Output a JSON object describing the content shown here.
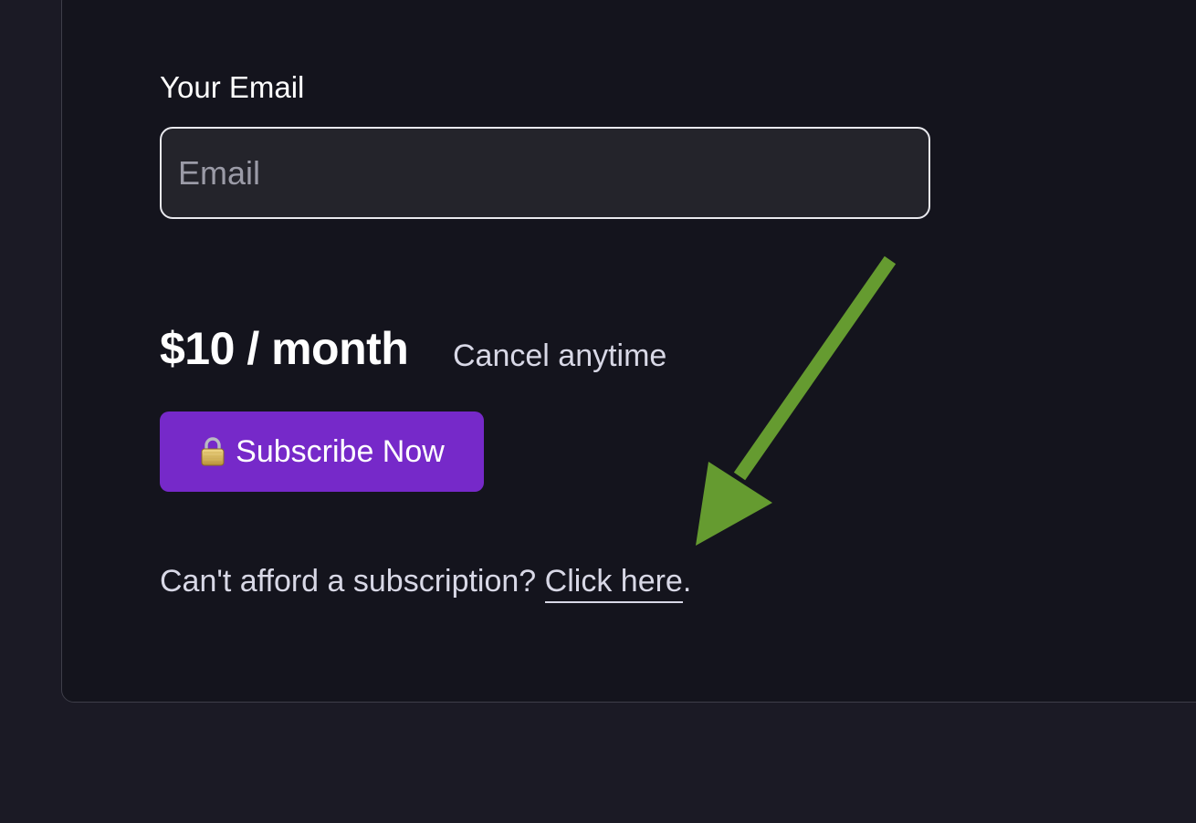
{
  "form": {
    "email_label": "Your Email",
    "email_placeholder": "Email",
    "email_value": ""
  },
  "pricing": {
    "price": "$10 / month",
    "note": "Cancel anytime"
  },
  "subscribe": {
    "icon": "lock-icon",
    "label": "Subscribe Now"
  },
  "afford": {
    "prefix": "Can't afford a subscription? ",
    "link_label": "Click here",
    "suffix": "."
  },
  "colors": {
    "page_background": "#1b1a25",
    "card_background": "#14141d",
    "button_purple": "#7629c9",
    "annotation_arrow_green": "#659b30"
  }
}
